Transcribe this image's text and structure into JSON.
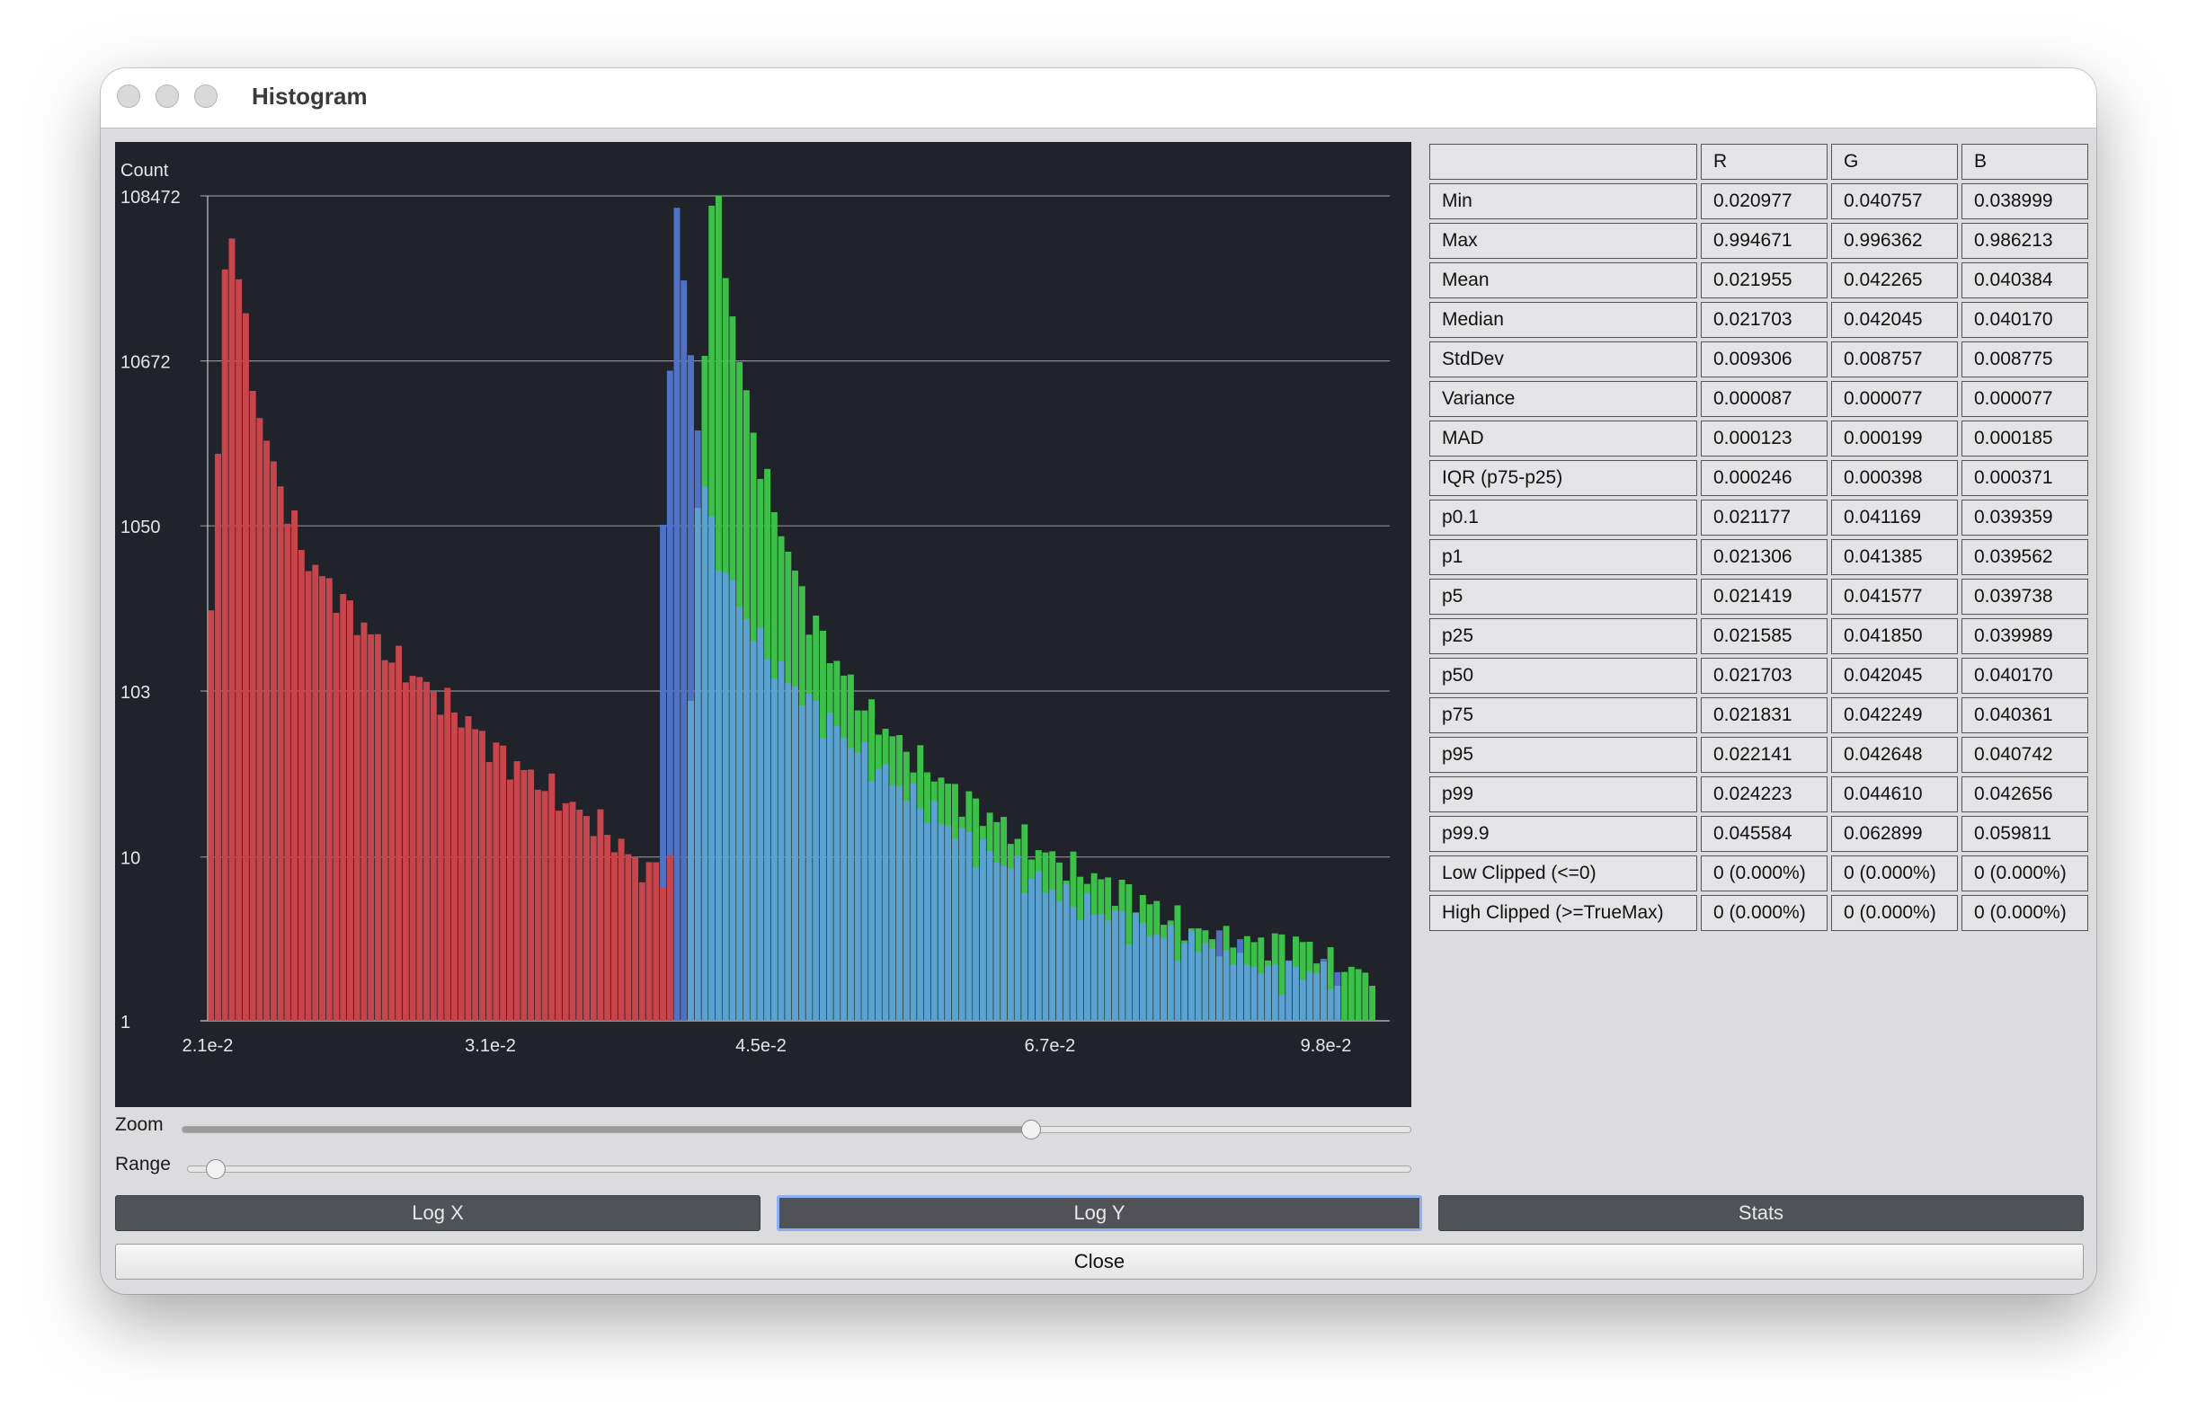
{
  "window": {
    "title": "Histogram"
  },
  "colors": {
    "red": "#c8464b",
    "green": "#3cc04a",
    "blue": "#4f72c6",
    "cyan": "#5ba2d2",
    "plot_bg": "#20232a"
  },
  "chart_data": {
    "type": "bar",
    "ylabel": "Count",
    "y_scale": "log",
    "x_scale": "log",
    "ylim": [
      1,
      108472
    ],
    "yticks": [
      "108472",
      "10672",
      "1050",
      "103",
      "10",
      "1"
    ],
    "xlim": [
      0.021,
      0.107
    ],
    "xticks": [
      "2.1e-2",
      "3.1e-2",
      "4.5e-2",
      "6.7e-2",
      "9.8e-2"
    ],
    "grid": true,
    "series": [
      {
        "name": "R",
        "x": [
          0.021,
          0.0213,
          0.0216,
          0.0219,
          0.0222,
          0.0225,
          0.023,
          0.0235,
          0.024,
          0.025,
          0.026,
          0.027,
          0.028,
          0.029,
          0.03,
          0.031,
          0.032,
          0.033,
          0.034,
          0.035,
          0.036,
          0.037,
          0.038,
          0.039,
          0.04
        ],
        "values": [
          100,
          2800,
          100000,
          40000,
          13000,
          5400,
          2400,
          1300,
          680,
          420,
          260,
          170,
          125,
          92,
          68,
          48,
          37,
          30,
          24,
          19,
          16,
          12,
          9,
          8,
          10
        ]
      },
      {
        "name": "G",
        "x": [
          0.0405,
          0.041,
          0.0415,
          0.042,
          0.0425,
          0.043,
          0.044,
          0.045,
          0.046,
          0.047,
          0.048,
          0.05,
          0.052,
          0.055,
          0.058,
          0.062,
          0.066,
          0.07,
          0.075,
          0.08,
          0.085,
          0.09,
          0.095,
          0.1,
          0.105
        ],
        "values": [
          12,
          200,
          6000,
          100000,
          90000,
          30000,
          7000,
          2500,
          1200,
          600,
          320,
          150,
          80,
          45,
          28,
          17,
          11,
          8,
          6,
          4,
          3,
          3,
          3,
          2,
          2
        ]
      },
      {
        "name": "B",
        "x": [
          0.039,
          0.0395,
          0.04,
          0.0405,
          0.041,
          0.0415,
          0.042,
          0.043,
          0.044,
          0.045,
          0.046,
          0.048,
          0.05,
          0.052,
          0.055,
          0.058,
          0.062,
          0.066,
          0.07,
          0.075,
          0.08,
          0.085,
          0.09,
          0.095,
          0.1
        ],
        "values": [
          110,
          3000,
          100000,
          30000,
          8000,
          2500,
          1000,
          500,
          300,
          200,
          140,
          90,
          60,
          40,
          25,
          16,
          10,
          7,
          5,
          4,
          3,
          3,
          2,
          2,
          2
        ]
      }
    ]
  },
  "controls": {
    "zoom_label": "Zoom",
    "range_label": "Range",
    "zoom_value": 0.69,
    "range_value": 0.015
  },
  "buttons": {
    "log_x": "Log X",
    "log_y": "Log Y",
    "stats": "Stats",
    "close": "Close"
  },
  "stats": {
    "header": [
      "",
      "R",
      "G",
      "B"
    ],
    "rows": [
      [
        "Min",
        "0.020977",
        "0.040757",
        "0.038999"
      ],
      [
        "Max",
        "0.994671",
        "0.996362",
        "0.986213"
      ],
      [
        "Mean",
        "0.021955",
        "0.042265",
        "0.040384"
      ],
      [
        "Median",
        "0.021703",
        "0.042045",
        "0.040170"
      ],
      [
        "StdDev",
        "0.009306",
        "0.008757",
        "0.008775"
      ],
      [
        "Variance",
        "0.000087",
        "0.000077",
        "0.000077"
      ],
      [
        "MAD",
        "0.000123",
        "0.000199",
        "0.000185"
      ],
      [
        "IQR (p75-p25)",
        "0.000246",
        "0.000398",
        "0.000371"
      ],
      [
        "p0.1",
        "0.021177",
        "0.041169",
        "0.039359"
      ],
      [
        "p1",
        "0.021306",
        "0.041385",
        "0.039562"
      ],
      [
        "p5",
        "0.021419",
        "0.041577",
        "0.039738"
      ],
      [
        "p25",
        "0.021585",
        "0.041850",
        "0.039989"
      ],
      [
        "p50",
        "0.021703",
        "0.042045",
        "0.040170"
      ],
      [
        "p75",
        "0.021831",
        "0.042249",
        "0.040361"
      ],
      [
        "p95",
        "0.022141",
        "0.042648",
        "0.040742"
      ],
      [
        "p99",
        "0.024223",
        "0.044610",
        "0.042656"
      ],
      [
        "p99.9",
        "0.045584",
        "0.062899",
        "0.059811"
      ],
      [
        "Low Clipped (<=0)",
        "0 (0.000%)",
        "0 (0.000%)",
        "0 (0.000%)"
      ],
      [
        "High Clipped (>=TrueMax)",
        "0 (0.000%)",
        "0 (0.000%)",
        "0 (0.000%)"
      ]
    ]
  }
}
